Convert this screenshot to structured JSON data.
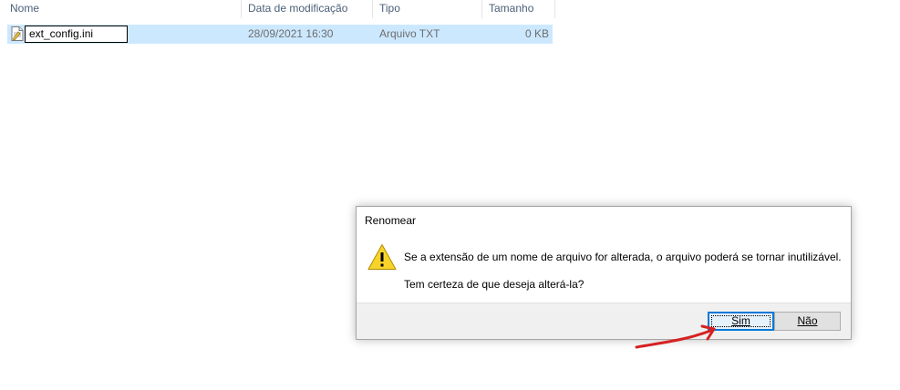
{
  "columns": {
    "name": "Nome",
    "date": "Data de modificação",
    "type": "Tipo",
    "size": "Tamanho"
  },
  "file": {
    "name": "ext_config.ini",
    "date": "28/09/2021 16:30",
    "type": "Arquivo TXT",
    "size": "0 KB"
  },
  "dialog": {
    "title": "Renomear",
    "message_line1": "Se a extensão de um nome de arquivo for alterada, o arquivo poderá se tornar inutilizável.",
    "message_line2": "Tem certeza de que deseja alterá-la?",
    "yes_label": "Sim",
    "no_label": "Não"
  },
  "colors": {
    "selection": "#cce8ff",
    "accent": "#0078d7",
    "annotation_arrow": "#d62121",
    "warning": "#f8d42b"
  },
  "icons": {
    "file": "text-file-icon",
    "warning": "warning-icon",
    "annotation": "red-arrow-annotation"
  }
}
